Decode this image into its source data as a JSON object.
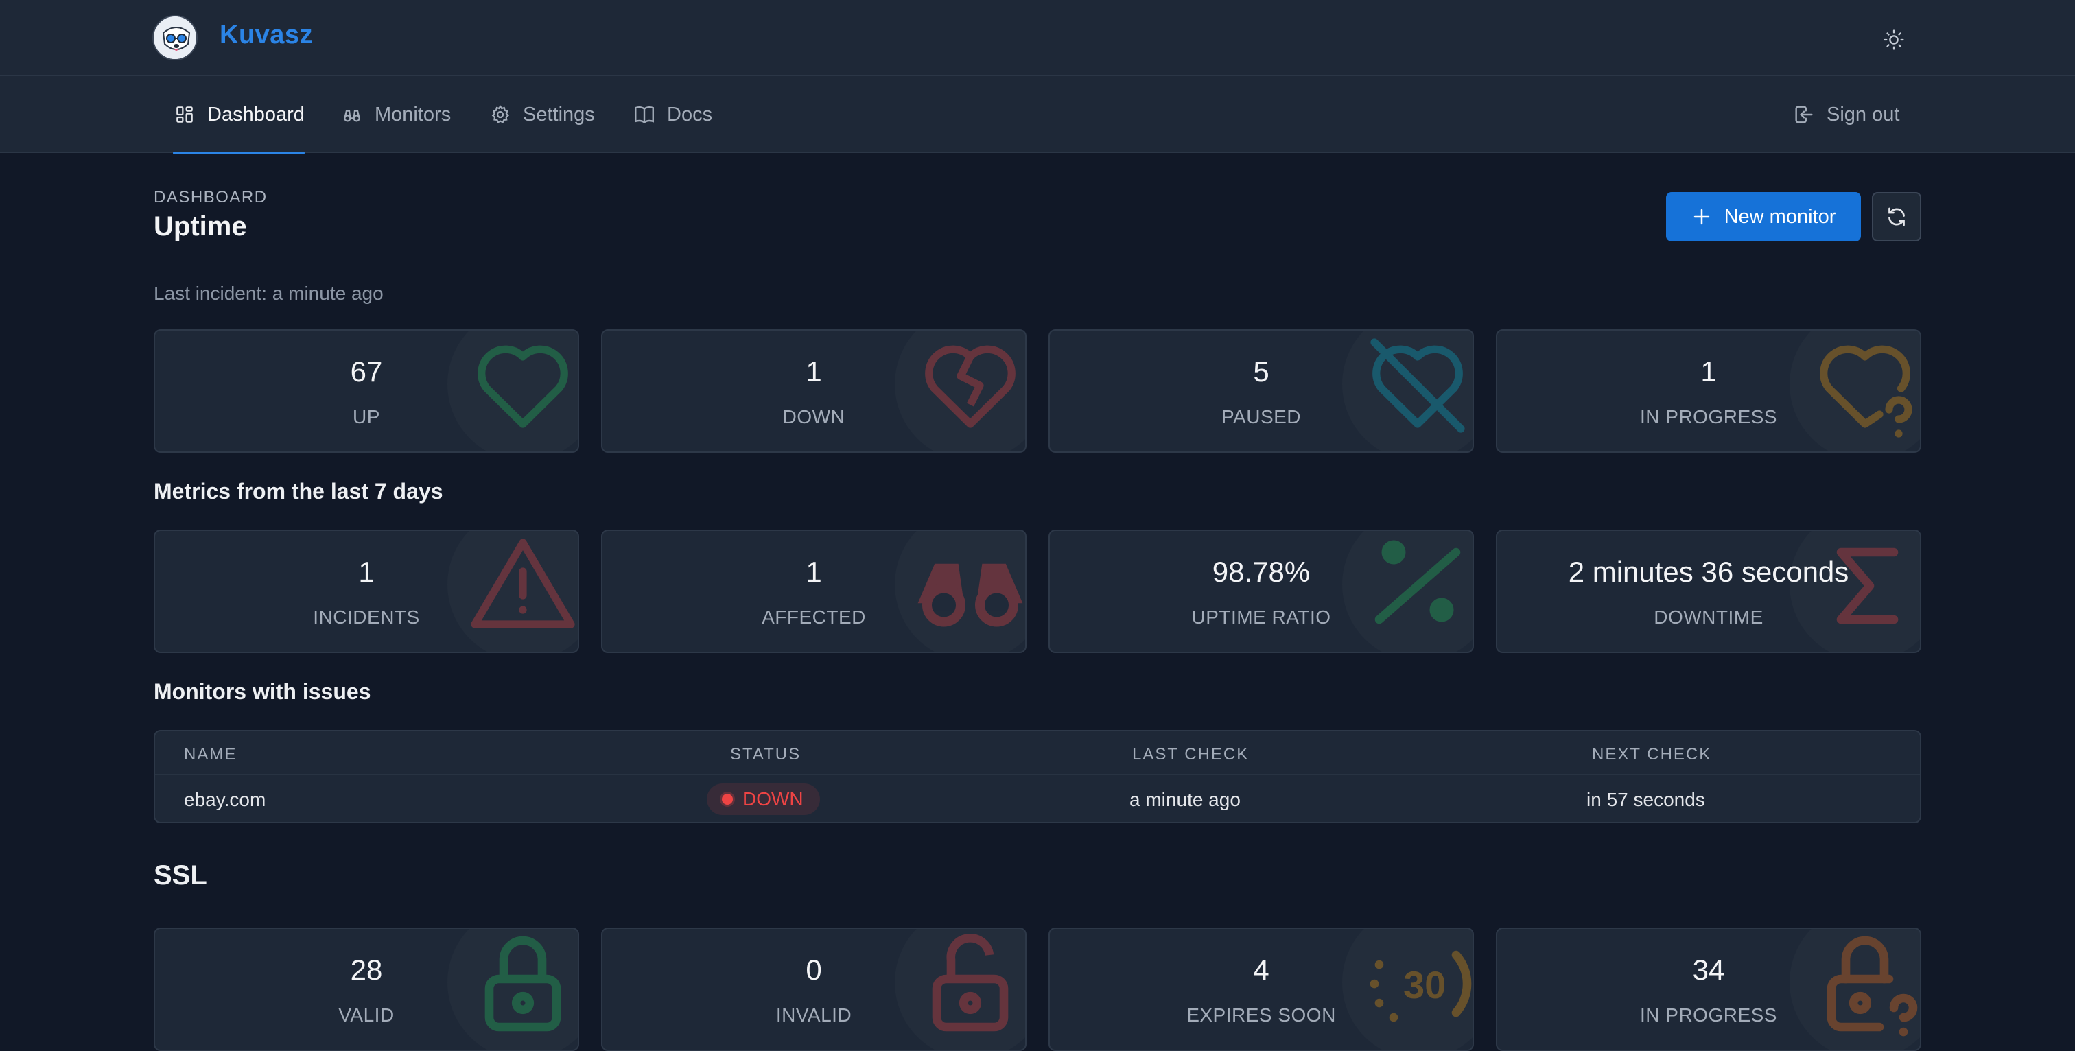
{
  "app": {
    "name": "Kuvasz"
  },
  "nav": {
    "dashboard": "Dashboard",
    "monitors": "Monitors",
    "settings": "Settings",
    "docs": "Docs",
    "sign_out": "Sign out"
  },
  "page": {
    "eyebrow": "DASHBOARD",
    "title": "Uptime",
    "last_incident": "Last incident: a minute ago",
    "new_monitor": "New monitor"
  },
  "status_cards": [
    {
      "value": "67",
      "label": "UP",
      "icon": "heart-icon",
      "color": "#22c55e"
    },
    {
      "value": "1",
      "label": "DOWN",
      "icon": "heart-broken-icon",
      "color": "#ef4444"
    },
    {
      "value": "5",
      "label": "PAUSED",
      "icon": "heart-off-icon",
      "color": "#06b6d4"
    },
    {
      "value": "1",
      "label": "IN PROGRESS",
      "icon": "heart-question-icon",
      "color": "#f59e0b"
    }
  ],
  "metrics": {
    "title": "Metrics from the last 7 days",
    "cards": [
      {
        "value": "1",
        "label": "INCIDENTS",
        "icon": "alert-triangle-icon",
        "color": "#ef4444"
      },
      {
        "value": "1",
        "label": "AFFECTED",
        "icon": "binoculars-icon",
        "color": "#ef4444"
      },
      {
        "value": "98.78%",
        "label": "UPTIME RATIO",
        "icon": "percentage-icon",
        "color": "#22c55e"
      },
      {
        "value": "2 minutes 36 seconds",
        "label": "DOWNTIME",
        "icon": "sigma-icon",
        "color": "#ef4444"
      }
    ]
  },
  "issues": {
    "title": "Monitors with issues",
    "columns": [
      "NAME",
      "STATUS",
      "LAST CHECK",
      "NEXT CHECK"
    ],
    "rows": [
      {
        "name": "ebay.com",
        "status": "DOWN",
        "last_check": "a minute ago",
        "next_check": "in 57 seconds"
      }
    ]
  },
  "ssl": {
    "title": "SSL",
    "cards": [
      {
        "value": "28",
        "label": "VALID",
        "icon": "lock-icon",
        "color": "#22c55e"
      },
      {
        "value": "0",
        "label": "INVALID",
        "icon": "lock-open-icon",
        "color": "#ef4444"
      },
      {
        "value": "4",
        "label": "EXPIRES SOON",
        "icon": "calendar-30-icon",
        "color": "#f59e0b"
      },
      {
        "value": "34",
        "label": "IN PROGRESS",
        "icon": "lock-question-icon",
        "color": "#f97316"
      }
    ]
  },
  "colors": {
    "accent": "#1672d8",
    "brand": "#2b84e6",
    "down": "#ef4444"
  }
}
